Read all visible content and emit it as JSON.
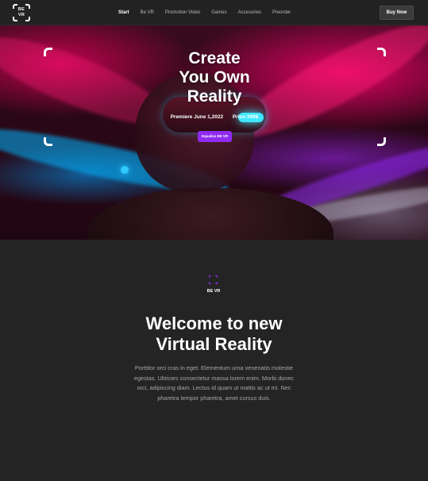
{
  "brand": {
    "logo_text_line1": "BE",
    "logo_text_line2": "VR"
  },
  "nav": {
    "items": [
      {
        "label": "Start",
        "active": true
      },
      {
        "label": "Be VR",
        "active": false
      },
      {
        "label": "Promotion Video",
        "active": false
      },
      {
        "label": "Games",
        "active": false
      },
      {
        "label": "Accesories",
        "active": false
      },
      {
        "label": "Preorder",
        "active": false
      }
    ],
    "cta_label": "Buy Now"
  },
  "hero": {
    "title_line1": "Create",
    "title_line2": "You Own",
    "title_line3": "Reality",
    "premiere": "Premiere June 1,2022",
    "price": "Price:399$",
    "button_label": "Equalize BE VR"
  },
  "intro": {
    "logo_label": "BE VR",
    "heading_line1": "Welcome to new",
    "heading_line2": "Virtual Reality",
    "paragraph": "Porttitor orci cras in eget. Elementum urna venenatis molestie egestas. Ultricies consectetur massa lorem enim. Morbi donec orci, adipiscing diam. Lectus id quam ut mattis ac ut mi. Nec pharetra tempor pharetra, amet cursus duis."
  },
  "colors": {
    "background": "#242424",
    "accent": "#8f2bf0",
    "topbar": "#222222"
  },
  "icons": {
    "logo": "bracket-frame-logo-icon",
    "section_logo": "bracket-frame-icon"
  }
}
